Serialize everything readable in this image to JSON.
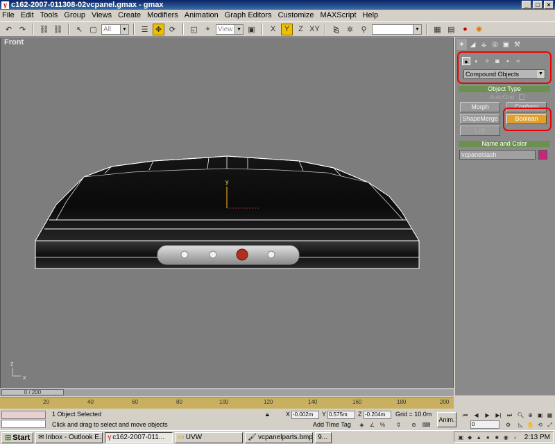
{
  "window": {
    "title": "c162-2007-011308-02vcpanel.gmax - gmax",
    "app_icon": "gmax-logo-icon"
  },
  "menu": [
    "File",
    "Edit",
    "Tools",
    "Group",
    "Views",
    "Create",
    "Modifiers",
    "Animation",
    "Graph Editors",
    "Customize",
    "MAXScript",
    "Help"
  ],
  "toolbar": {
    "selection_filter": "All",
    "ref_coord": "View",
    "named_selection": ""
  },
  "viewport": {
    "label": "Front",
    "gizmo_y_label": "y",
    "corner_axis_x": "x",
    "corner_axis_z": "z"
  },
  "command_panel": {
    "category": "Compound Objects",
    "object_type_header": "Object Type",
    "autogrid_label": "AutoGrid",
    "buttons": {
      "morph": "Morph",
      "conform": "Conform",
      "shapemerge": "ShapeMerge",
      "boolean": "Boolean",
      "loft": "Loft"
    },
    "name_color_header": "Name and Color",
    "object_name": "vcpaneldash",
    "object_color": "#c8267a"
  },
  "timeline": {
    "frame_display": "0 / 200",
    "ticks": [
      "20",
      "40",
      "60",
      "80",
      "100",
      "120",
      "140",
      "160",
      "180",
      "200"
    ]
  },
  "status": {
    "selection": "1 Object Selected",
    "prompt": "Click and drag to select and move objects",
    "x_label": "X",
    "x_value": "-0.002m",
    "y_label": "Y",
    "y_value": "0.575m",
    "z_label": "Z",
    "z_value": "-0.204m",
    "grid": "Grid = 10.0m",
    "add_time_tag": "Add Time Tag",
    "anim_button": "Anim.",
    "frame_field": "0"
  },
  "taskbar": {
    "start": "Start",
    "tasks": [
      "Inbox - Outlook E...",
      "c162-2007-011...",
      "UVW",
      "vcpanelparts.bmp ...",
      "9..."
    ],
    "active_task_index": 1,
    "clock": "2:13 PM"
  }
}
